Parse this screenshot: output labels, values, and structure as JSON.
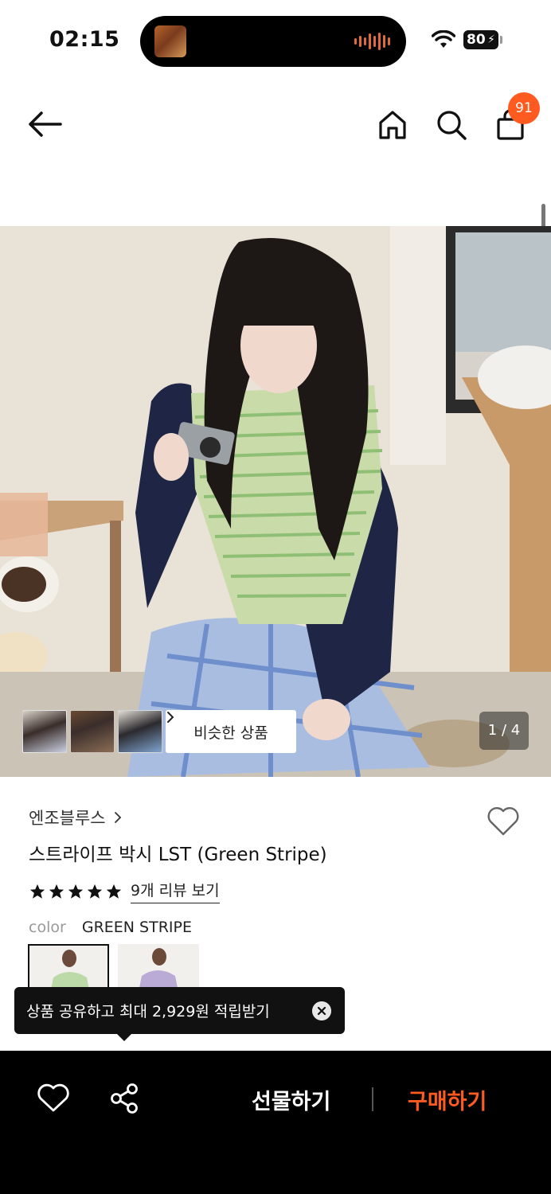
{
  "status_bar": {
    "time": "02:15",
    "battery": "80"
  },
  "nav": {
    "cart_count": "91"
  },
  "gallery": {
    "similar_button": "비슷한 상품",
    "page_indicator": "1 / 4"
  },
  "product": {
    "brand": "엔조블루스",
    "title": "스트라이프 박시 LST (Green Stripe)",
    "rating_stars": 5,
    "review_link": "9개 리뷰 보기",
    "color_label": "color",
    "color_value": "GREEN STRIPE"
  },
  "tooltip": {
    "text": "상품 공유하고 최대 2,929원 적립받기"
  },
  "bottom_bar": {
    "gift_label": "선물하기",
    "buy_label": "구매하기"
  },
  "colors": {
    "accent": "#ff5a1f",
    "dark": "#000000"
  }
}
